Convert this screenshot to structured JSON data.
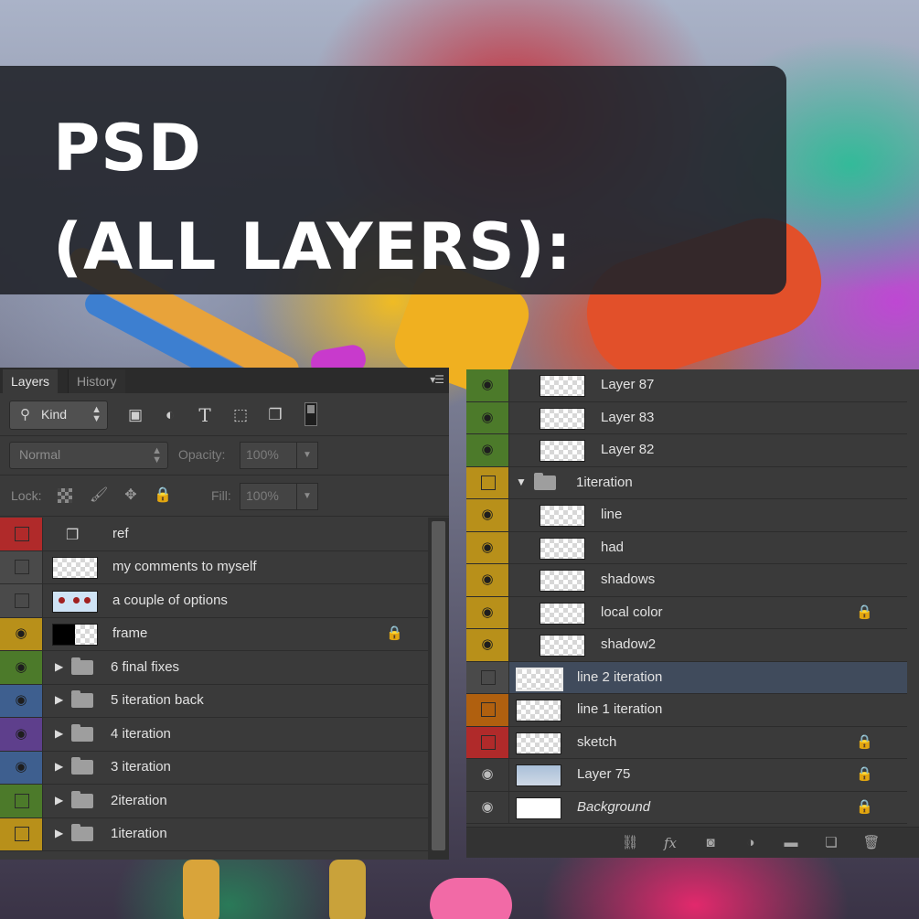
{
  "banner": {
    "line1": "PSD",
    "line2": "(ALL LAYERS):"
  },
  "colors": {
    "red": "#b02a2a",
    "gray": "#4a4a4a",
    "yellow": "#b8901a",
    "green": "#4c7a2a",
    "blue": "#3e5f8f",
    "purple": "#5e3f8c",
    "orange": "#b0600f",
    "selected": "#404b5c"
  },
  "left_panel": {
    "tabs": [
      "Layers",
      "History"
    ],
    "filter": {
      "kind_label": "Kind"
    },
    "blend_mode": "Normal",
    "opacity_label": "Opacity:",
    "opacity_value": "100%",
    "lock_label": "Lock:",
    "fill_label": "Fill:",
    "fill_value": "100%",
    "layers": [
      {
        "name": "ref",
        "color": "red",
        "visible": false,
        "type": "smart"
      },
      {
        "name": "my comments to myself",
        "color": "gray",
        "visible": false,
        "type": "layer"
      },
      {
        "name": "a couple of options",
        "color": "gray",
        "visible": false,
        "type": "pics"
      },
      {
        "name": "frame",
        "color": "yellow",
        "visible": true,
        "type": "dark",
        "locked": true
      },
      {
        "name": "6 final fixes",
        "color": "green",
        "visible": true,
        "type": "group"
      },
      {
        "name": "5 iteration back",
        "color": "blue",
        "visible": true,
        "type": "group"
      },
      {
        "name": "4 iteration",
        "color": "purple",
        "visible": true,
        "type": "group"
      },
      {
        "name": "3 iteration",
        "color": "blue",
        "visible": true,
        "type": "group"
      },
      {
        "name": "2iteration",
        "color": "green",
        "visible": false,
        "type": "group"
      },
      {
        "name": "1iteration",
        "color": "yellow",
        "visible": false,
        "type": "group"
      }
    ]
  },
  "right_panel": {
    "layers": [
      {
        "name": "Layer 87",
        "color": "green",
        "visible": true,
        "indent": 2,
        "thumb": "layer"
      },
      {
        "name": "Layer 83",
        "color": "green",
        "visible": true,
        "indent": 2,
        "thumb": "layer"
      },
      {
        "name": "Layer 82",
        "color": "green",
        "visible": true,
        "indent": 2,
        "thumb": "layer"
      },
      {
        "name": "1iteration",
        "color": "yellow",
        "visible": false,
        "indent": 1,
        "thumb": "open-group"
      },
      {
        "name": "line",
        "color": "yellow",
        "visible": true,
        "indent": 2,
        "thumb": "layer"
      },
      {
        "name": "had",
        "color": "yellow",
        "visible": true,
        "indent": 2,
        "thumb": "layer"
      },
      {
        "name": "shadows",
        "color": "yellow",
        "visible": true,
        "indent": 2,
        "thumb": "layer"
      },
      {
        "name": "local color",
        "color": "yellow",
        "visible": true,
        "indent": 2,
        "thumb": "layer",
        "locked": true
      },
      {
        "name": "shadow2",
        "color": "yellow",
        "visible": true,
        "indent": 2,
        "thumb": "layer"
      },
      {
        "name": "line 2 iteration",
        "color": "gray",
        "visible": false,
        "indent": 1,
        "thumb": "layer",
        "selected": true
      },
      {
        "name": "line 1 iteration",
        "color": "orange",
        "visible": false,
        "indent": 1,
        "thumb": "layer"
      },
      {
        "name": "sketch",
        "color": "red",
        "visible": false,
        "indent": 1,
        "thumb": "layer",
        "locked": true
      },
      {
        "name": "Layer 75",
        "color": "none",
        "visible": true,
        "indent": 1,
        "thumb": "blue",
        "locked": true
      },
      {
        "name": "Background",
        "color": "none",
        "visible": true,
        "indent": 1,
        "thumb": "white",
        "locked": true,
        "italic": true
      }
    ],
    "footer_tools": [
      "link-icon",
      "fx-icon",
      "mask-icon",
      "adjustment-icon",
      "new-group-icon",
      "new-layer-icon",
      "trash-icon"
    ]
  }
}
